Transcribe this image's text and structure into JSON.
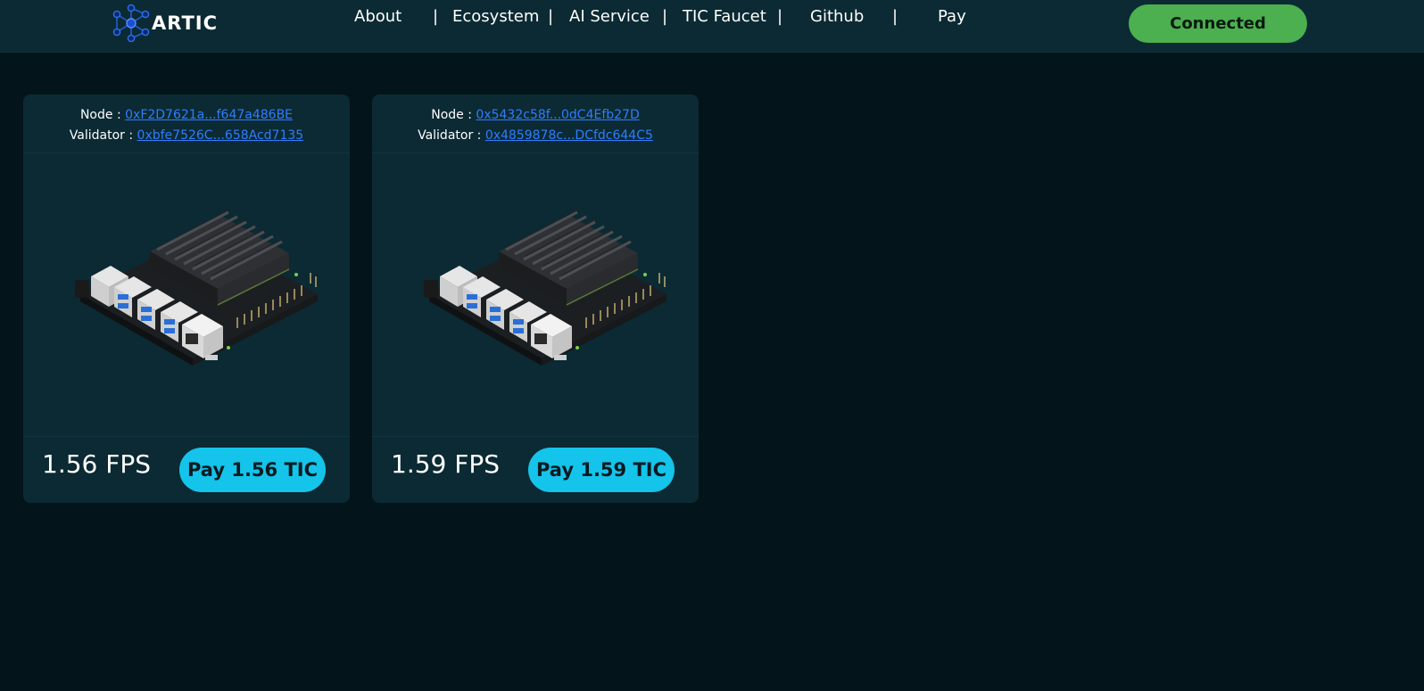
{
  "header": {
    "logo_text": "ARTIC",
    "nav": [
      {
        "label": "About"
      },
      {
        "label": "Ecosystem"
      },
      {
        "label": "AI Service"
      },
      {
        "label": "TIC Faucet"
      },
      {
        "label": "Github"
      },
      {
        "label": "Pay"
      }
    ],
    "separator": "|",
    "status_button": "Connected"
  },
  "cards": [
    {
      "node_label": "Node :",
      "node_address": "0xF2D7621a...f647a486BE",
      "validator_label": "Validator :",
      "validator_address": "0xbfe7526C...658Acd7135",
      "fps": "1.56 FPS",
      "pay_label": "Pay 1.56 TIC"
    },
    {
      "node_label": "Node :",
      "node_address": "0x5432c58f...0dC4Efb27D",
      "validator_label": "Validator :",
      "validator_address": "0x4859878c...DCfdc644C5",
      "fps": "1.59 FPS",
      "pay_label": "Pay 1.59 TIC"
    }
  ],
  "colors": {
    "page_bg": "#03141a",
    "panel_bg": "#0b2a33",
    "link": "#2f7dff",
    "connected_bg": "#4caf50",
    "pay_bg": "#14c4ea"
  },
  "icons": {
    "logo": "molecule-network-icon",
    "board": "jetson-board-image"
  }
}
